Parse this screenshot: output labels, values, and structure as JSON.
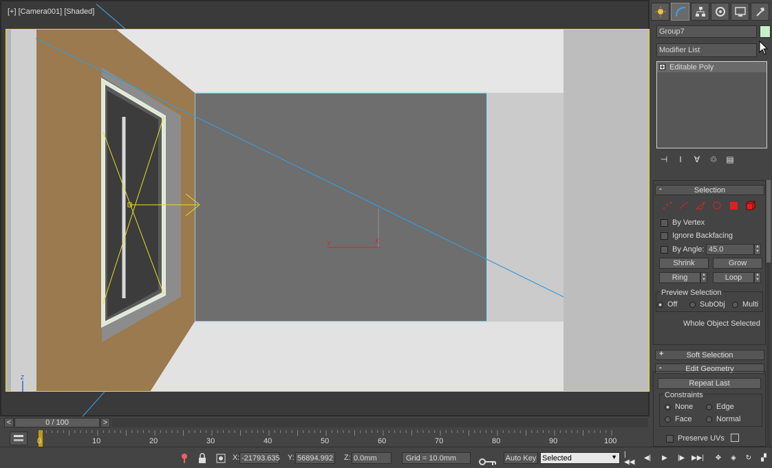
{
  "viewport": {
    "label": "[+] [Camera001] [Shaded]",
    "gizmo": {
      "y_label": "Y",
      "x_label": "X"
    },
    "axis_tripod": {
      "z_label": "Z"
    }
  },
  "command_panel": {
    "tabs": [
      {
        "name": "create",
        "icon": "sun-icon"
      },
      {
        "name": "modify",
        "icon": "curve-icon"
      },
      {
        "name": "hierarchy",
        "icon": "hierarchy-icon"
      },
      {
        "name": "motion",
        "icon": "motion-icon"
      },
      {
        "name": "display",
        "icon": "monitor-icon"
      },
      {
        "name": "utilities",
        "icon": "hammer-icon"
      }
    ],
    "object_name": "Group7",
    "object_color": "#c8f0c8",
    "modifier_list": "Modifier List",
    "modifier_stack": [
      "Editable Poly"
    ],
    "selection": {
      "title": "Selection",
      "by_vertex": "By Vertex",
      "ignore_backfacing": "Ignore Backfacing",
      "by_angle": "By Angle:",
      "angle_value": "45.0",
      "shrink": "Shrink",
      "grow": "Grow",
      "ring": "Ring",
      "loop": "Loop",
      "preview_selection": "Preview Selection",
      "preview_off": "Off",
      "preview_subobj": "SubObj",
      "preview_multi": "Multi",
      "status": "Whole Object Selected"
    },
    "soft_selection": {
      "title": "Soft Selection",
      "sign": "+"
    },
    "edit_geometry": {
      "title": "Edit Geometry",
      "sign": "-",
      "repeat_last": "Repeat Last",
      "constraints": "Constraints",
      "none": "None",
      "edge": "Edge",
      "face": "Face",
      "normal": "Normal",
      "preserve_uvs": "Preserve UVs"
    },
    "selection_sign": "-"
  },
  "timeline": {
    "frame": "0 / 100",
    "ticks": [
      "0",
      "10",
      "20",
      "30",
      "40",
      "50",
      "60",
      "70",
      "80",
      "90",
      "100"
    ]
  },
  "status_bar": {
    "x_label": "X:",
    "x_value": "-21793.635",
    "y_label": "Y:",
    "y_value": "56894.992",
    "z_label": "Z:",
    "z_value": "0.0mm",
    "grid": "Grid = 10.0mm",
    "auto_key": "Auto Key",
    "selected_dropdown": "Selected"
  },
  "colors": {
    "accent": "#2080c0",
    "wall": "#9a7a4e",
    "selection_red": "#ff2020"
  }
}
